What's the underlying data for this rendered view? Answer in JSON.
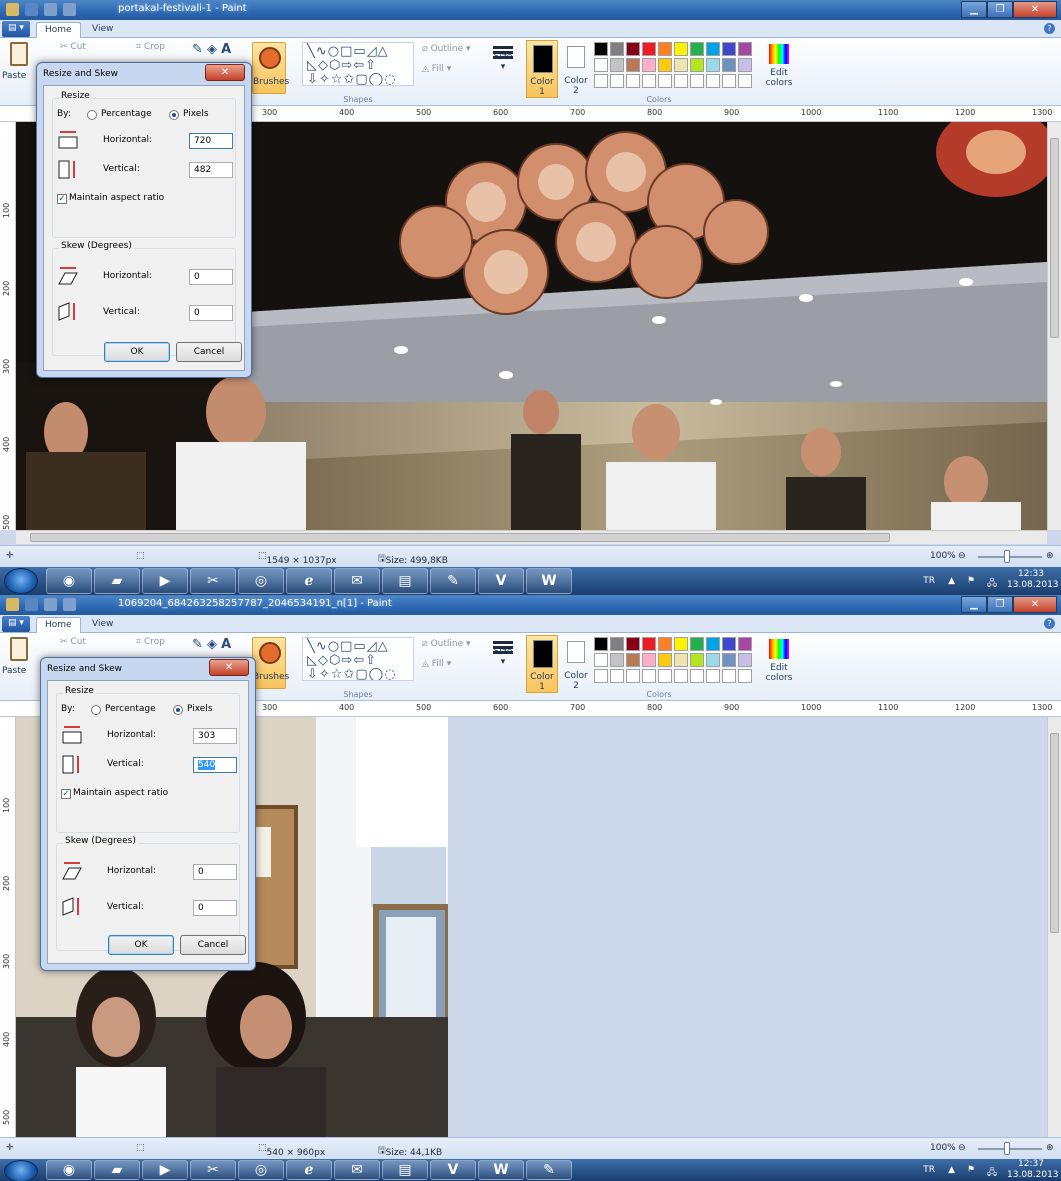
{
  "ui": {
    "tab_home": "Home",
    "tab_view": "View",
    "paste_label": "Paste",
    "cut_label": "Cut",
    "crop_label": "Crop",
    "text_tool": "A",
    "brushes_label": "Brushes",
    "shapes_label": "Shapes",
    "outline_label": "Outline",
    "fill_label": "Fill",
    "size_label": "Size",
    "color1_label": "Color\n1",
    "color2_label": "Color\n2",
    "edit_colors_label": "Edit\ncolors",
    "colors_group_label": "Colors",
    "palette": [
      "#000000",
      "#7f7f7f",
      "#880015",
      "#ed1c24",
      "#ff7f27",
      "#fff200",
      "#22b14c",
      "#00a2e8",
      "#3f48cc",
      "#a349a4",
      "#ffffff",
      "#c3c3c3",
      "#b97a57",
      "#ffaec9",
      "#ffc90e",
      "#efe4b0",
      "#b5e61d",
      "#99d9ea",
      "#7092be",
      "#c8bfe7"
    ],
    "ruler_h": [
      "300",
      "400",
      "500",
      "600",
      "700",
      "800",
      "900",
      "1000",
      "1100",
      "1200",
      "1300"
    ],
    "ruler_v": [
      "100",
      "200",
      "300",
      "400",
      "500"
    ],
    "zoom_label": "100%"
  },
  "window1": {
    "title": "portakal-festivali-1 - Paint",
    "status_dimensions": "1549 × 1037px",
    "status_size": "Size: 499,8KB",
    "dialog": {
      "title": "Resize and Skew",
      "resize_legend": "Resize",
      "by_label": "By:",
      "percentage_label": "Percentage",
      "pixels_label": "Pixels",
      "horizontal_label": "Horizontal:",
      "vertical_label": "Vertical:",
      "horizontal_value": "720",
      "vertical_value": "482",
      "aspect_label": "Maintain aspect ratio",
      "skew_legend": "Skew (Degrees)",
      "skew_horizontal_label": "Horizontal:",
      "skew_vertical_label": "Vertical:",
      "skew_horizontal_value": "0",
      "skew_vertical_value": "0",
      "ok_label": "OK",
      "cancel_label": "Cancel"
    }
  },
  "window2": {
    "title": "1069204_684263258257787_2046534191_n[1] - Paint",
    "status_dimensions": "540 × 960px",
    "status_size": "Size: 44,1KB",
    "dialog": {
      "title": "Resize and Skew",
      "resize_legend": "Resize",
      "by_label": "By:",
      "percentage_label": "Percentage",
      "pixels_label": "Pixels",
      "horizontal_label": "Horizontal:",
      "vertical_label": "Vertical:",
      "horizontal_value": "303",
      "vertical_value": "540",
      "aspect_label": "Maintain aspect ratio",
      "skew_legend": "Skew (Degrees)",
      "skew_horizontal_label": "Horizontal:",
      "skew_vertical_label": "Vertical:",
      "skew_horizontal_value": "0",
      "skew_vertical_value": "0",
      "ok_label": "OK",
      "cancel_label": "Cancel"
    }
  },
  "taskbar1": {
    "lang": "TR",
    "time": "12:33",
    "date": "13.08.2013"
  },
  "taskbar2": {
    "lang": "TR",
    "time": "12:37",
    "date": "13.08.2013"
  },
  "taskbar_apps": [
    "firefox-icon",
    "folder-icon",
    "media-player-icon",
    "snipping-tool-icon",
    "chrome-icon",
    "ie-icon",
    "outlook-icon",
    "explorer-icon",
    "paint-icon",
    "visio-icon",
    "word-icon"
  ]
}
